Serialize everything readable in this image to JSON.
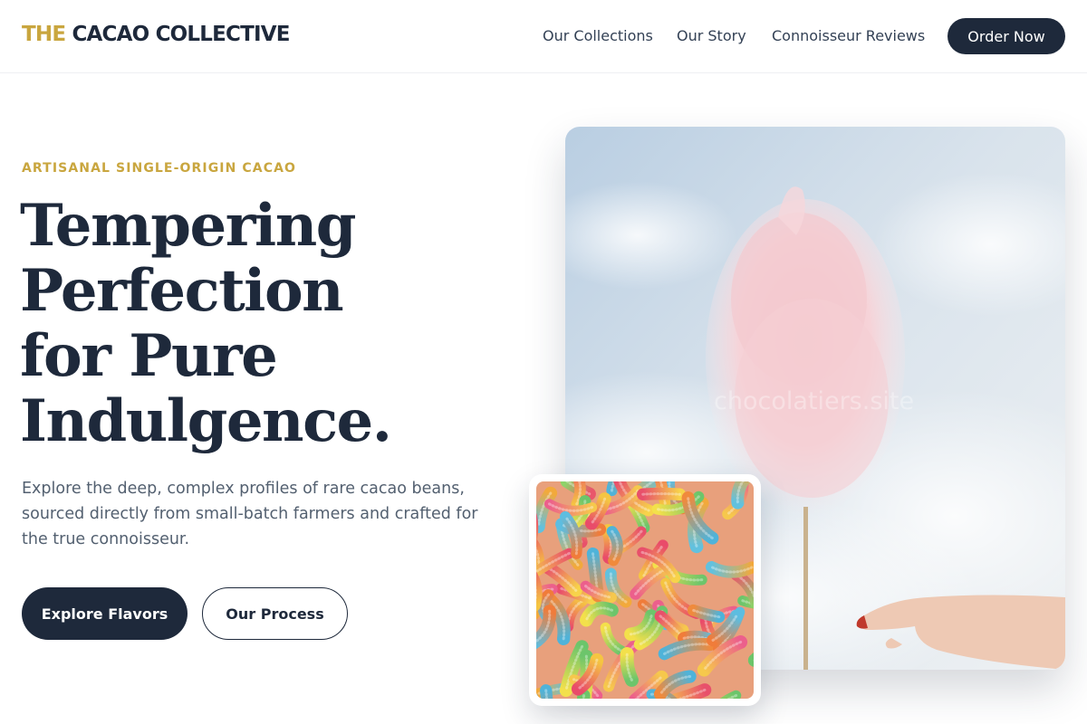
{
  "header": {
    "logo_accent": "THE",
    "logo_main": "CACAO COLLECTIVE",
    "nav": [
      "Our Collections",
      "Our Story",
      "Connoisseur Reviews"
    ],
    "cta_label": "Order Now"
  },
  "hero": {
    "eyebrow": "ARTISANAL SINGLE-ORIGIN CACAO",
    "headline_lines": [
      "Tempering",
      "Perfection",
      "for Pure",
      "Indulgence."
    ],
    "subtext_lines": [
      "Explore the deep, complex profiles of rare cacao beans,",
      "sourced directly from small-batch farmers and crafted for",
      "the true connoisseur."
    ],
    "primary_button": "Explore Flavors",
    "secondary_button": "Our Process"
  },
  "images": {
    "main_watermark": "chocolatiers.site"
  },
  "colors": {
    "brand_dark": "#1e293b",
    "accent_gold": "#c9a63f"
  }
}
